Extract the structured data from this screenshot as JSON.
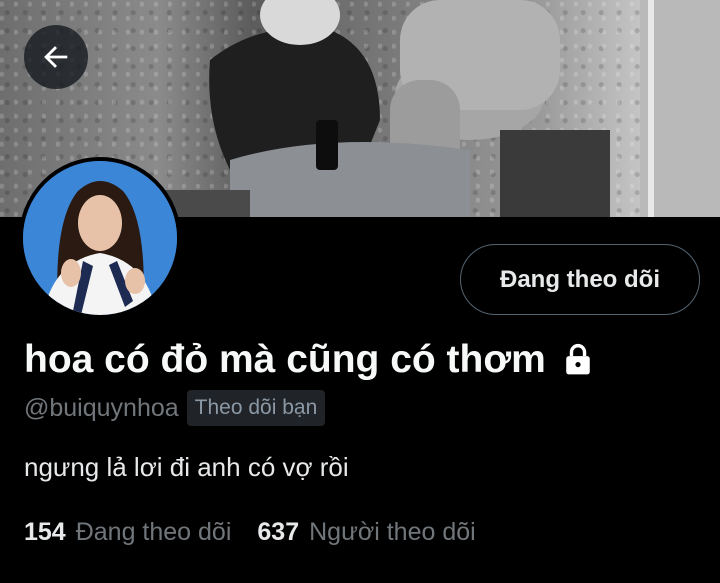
{
  "profile": {
    "display_name": "hoa có đỏ mà cũng có thơm",
    "handle": "@buiquynhoa",
    "follows_you_badge": "Theo dõi bạn",
    "bio": "ngưng lả lơi đi anh có vợ rồi",
    "following_count": "154",
    "following_label": "Đang theo dõi",
    "followers_count": "637",
    "followers_label": "Người theo dõi",
    "protected_icon": "lock-icon"
  },
  "actions": {
    "follow_button_label": "Đang theo dõi",
    "back_icon": "arrow-left-icon"
  },
  "colors": {
    "background": "#000000",
    "text_primary": "#e7e9ea",
    "text_secondary": "#71767b",
    "button_border": "#536471",
    "avatar_bg": "#3b86d6"
  }
}
